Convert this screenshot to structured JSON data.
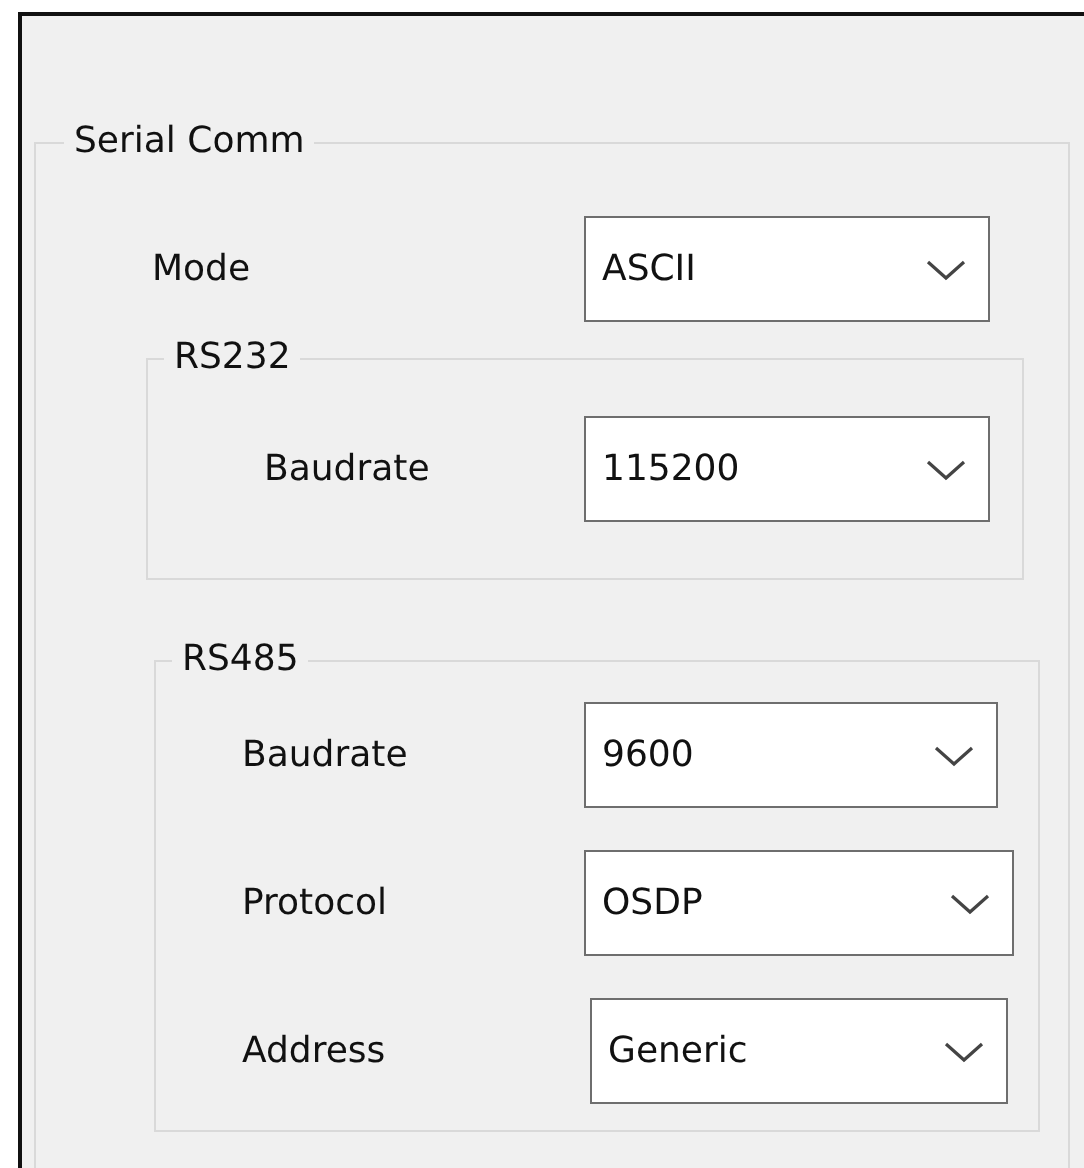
{
  "group": {
    "title": "Serial Comm",
    "fields": [
      {
        "label": "Mode",
        "value": "ASCII"
      }
    ],
    "subgroups": [
      {
        "title": "RS232",
        "fields": [
          {
            "label": "Baudrate",
            "value": "115200"
          }
        ]
      },
      {
        "title": "RS485",
        "fields": [
          {
            "label": "Baudrate",
            "value": "9600"
          },
          {
            "label": "Protocol",
            "value": "OSDP"
          },
          {
            "label": "Address",
            "value": "Generic"
          }
        ]
      }
    ]
  }
}
